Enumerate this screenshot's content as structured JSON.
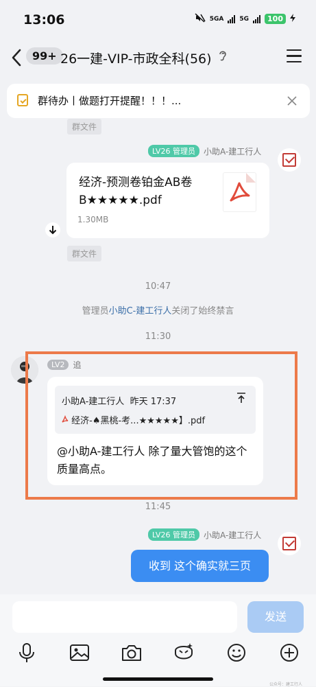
{
  "status_bar": {
    "time": "13:06",
    "net1": "5GA",
    "net2": "5G",
    "battery": "100"
  },
  "header": {
    "unread_badge": "99+",
    "title": "26一建-VIP-市政全科(56)"
  },
  "notice": {
    "text": "群待办丨做题打开提醒！！！..."
  },
  "chat": {
    "group_file_tag_top": "群文件",
    "msg1": {
      "level": "LV26 管理员",
      "sender": "小助A-建工行人",
      "file_name": "经济-预测卷铂金AB卷B★★★★★.pdf",
      "file_size": "1.30MB"
    },
    "group_file_tag_bottom": "群文件",
    "time1": "10:47",
    "system": {
      "prefix": "管理员",
      "name": "小助C-建工行人",
      "suffix": "关闭了始终禁言"
    },
    "time2": "11:30",
    "msg2": {
      "level": "LV2",
      "sender": "追",
      "quote_sender": "小助A-建工行人",
      "quote_time": "昨天 17:37",
      "quote_file": "经济-♠黑桃-考...★★★★★】.pdf",
      "text": "@小助A-建工行人 除了量大管饱的这个质量高点。"
    },
    "time3": "11:45",
    "msg3": {
      "level": "LV26 管理员",
      "sender": "小助A-建工行人",
      "text": "收到 这个确实就三页"
    }
  },
  "input": {
    "placeholder": "",
    "send_label": "发送"
  },
  "toolbar": [
    "microphone-icon",
    "image-icon",
    "camera-icon",
    "sticker-icon",
    "emoji-icon",
    "plus-icon"
  ],
  "watermark": "公众号：建工行人",
  "colors": {
    "accent": "#3b8df2",
    "level_badge": "#4fc9a8",
    "highlight": "#ec7a4a",
    "pdf_red": "#e14b3b"
  }
}
